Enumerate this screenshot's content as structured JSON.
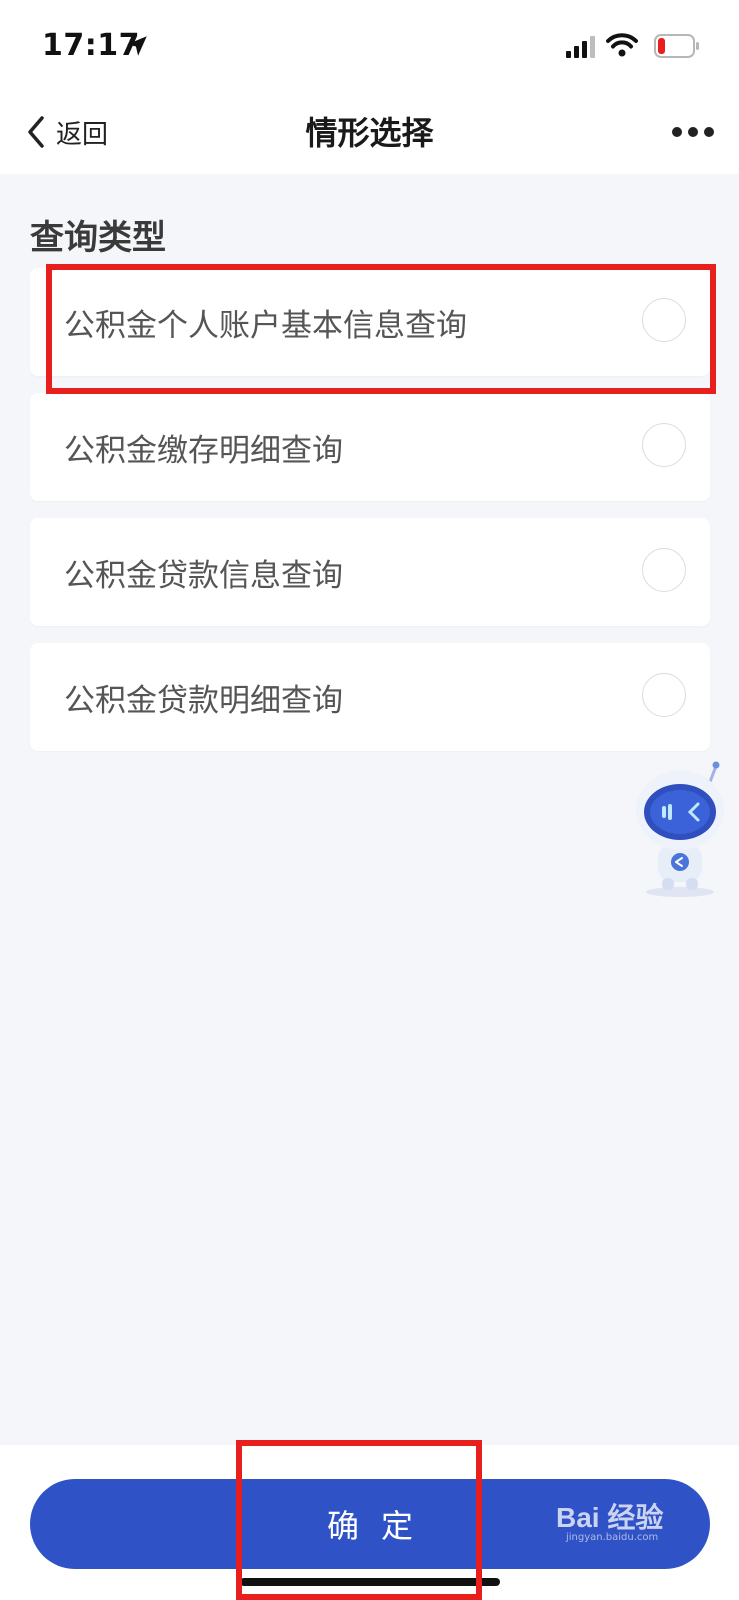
{
  "status_bar": {
    "time": "17:17",
    "battery_color": "#e8201d"
  },
  "nav": {
    "back_label": "返回",
    "title": "情形选择"
  },
  "section": {
    "title": "查询类型"
  },
  "options": [
    {
      "label": "公积金个人账户基本信息查询",
      "selected": false
    },
    {
      "label": "公积金缴存明细查询",
      "selected": false
    },
    {
      "label": "公积金贷款信息查询",
      "selected": false
    },
    {
      "label": "公积金贷款明细查询",
      "selected": false
    }
  ],
  "footer": {
    "confirm_label": "确定",
    "accent_color": "#2f52c6"
  },
  "watermark": {
    "text": "Bai 经验",
    "sub": "jingyan.baidu.com"
  },
  "icons": {
    "back": "chevron-left-icon",
    "more": "more-icon",
    "assistant": "robot-icon"
  }
}
